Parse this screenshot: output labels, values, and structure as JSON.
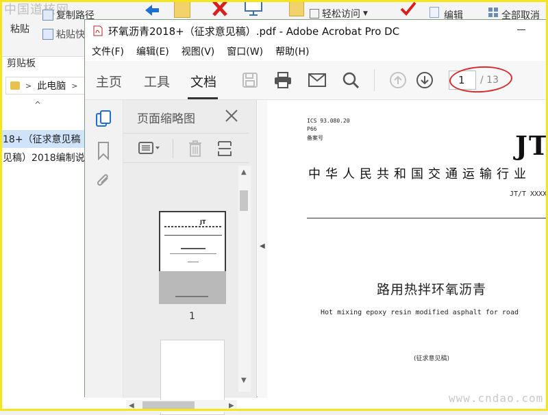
{
  "explorer": {
    "watermark_top": "中国道核网",
    "copy_path": "复制路径",
    "paste": "粘贴",
    "paste_shortcut": "粘贴快",
    "clipboard_group": "剪贴板",
    "easy_access": "轻松访问",
    "edit": "编辑",
    "cancel_all": "全部取消",
    "address_this_pc": "此电脑",
    "file_row_1": "18+（征求意见稿",
    "file_row_2": "见稿）2018编制说"
  },
  "acrobat": {
    "title": "环氧沥青2018+（征求意见稿）.pdf - Adobe Acrobat Pro DC",
    "menu": [
      "文件(F)",
      "编辑(E)",
      "视图(V)",
      "窗口(W)",
      "帮助(H)"
    ],
    "tabs": {
      "home": "主页",
      "tools": "工具",
      "document": "文档"
    },
    "page": {
      "current": "1",
      "total": "/ 13"
    },
    "thumb_panel": {
      "title": "页面缩略图",
      "page_label": "1"
    }
  },
  "document": {
    "ics": "ICS  93.080.20",
    "p66": "P66",
    "record": "备案号",
    "jt": "JT",
    "heading": "中华人民共和国交通运输行业",
    "std_number": "JT/T XXXX",
    "title_cn": "路用热拌环氧沥青",
    "title_en": "Hot mixing epoxy resin modified asphalt for road",
    "draft": "(征求意见稿)"
  },
  "watermark": "www.cndao.com",
  "colors": {
    "highlight_frame": "#f5e51a",
    "annotation_oval": "#d92b2b",
    "window_border": "#7a9f7a"
  }
}
